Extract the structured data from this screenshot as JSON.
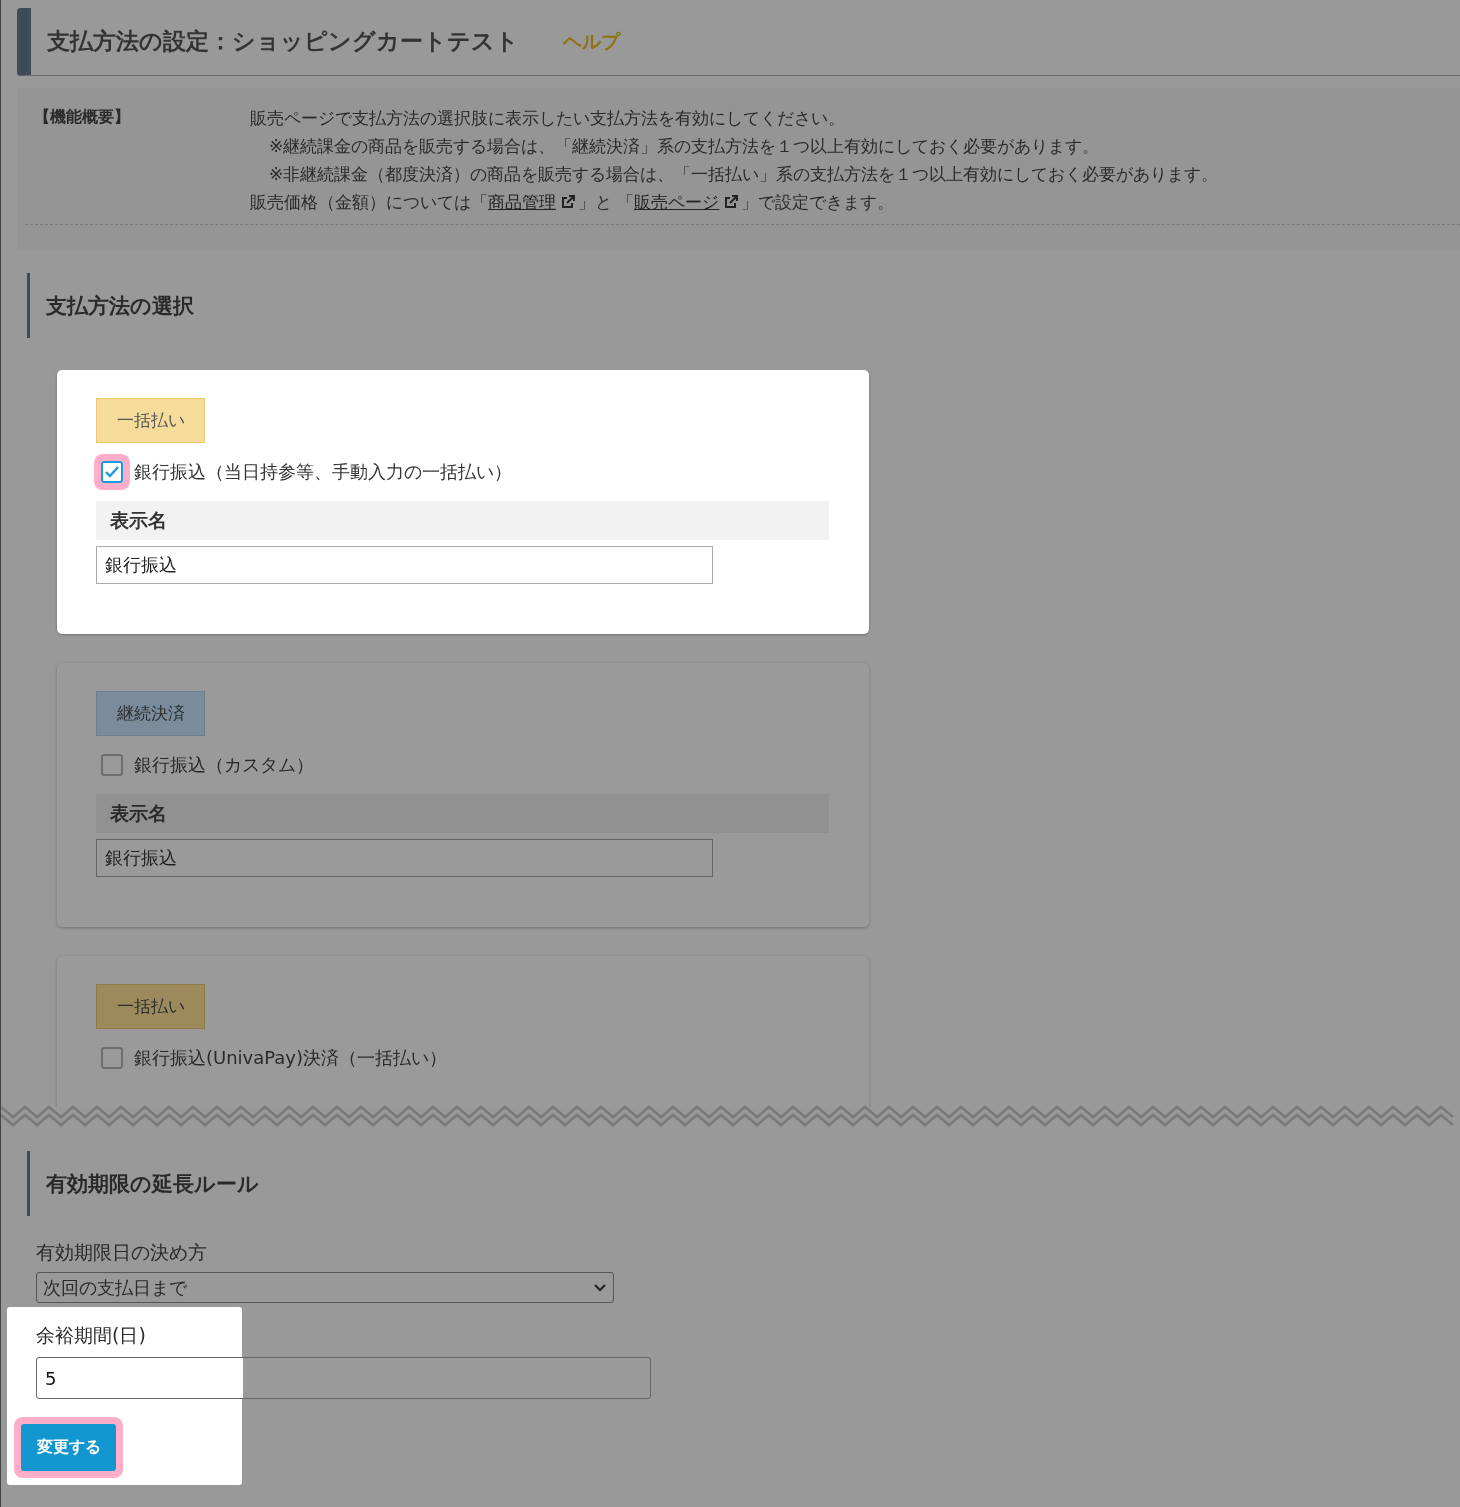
{
  "header": {
    "title": "支払方法の設定：ショッピングカートテスト",
    "help_link": "ヘルプ"
  },
  "overview": {
    "label": "【機能概要】",
    "lines": [
      {
        "kind": "main",
        "text": "販売ページで支払方法の選択肢に表示したい支払方法を有効にしてください。"
      },
      {
        "kind": "note",
        "text": "※継続課金の商品を販売する場合は、「継続決済」系の支払方法を１つ以上有効にしておく必要があります。"
      },
      {
        "kind": "note",
        "text": "※非継続課金（都度決済）の商品を販売する場合は、「一括払い」系の支払方法を１つ以上有効にしておく必要があります。"
      }
    ],
    "price_note": {
      "before": "販売価格（金額）については「",
      "link_1": "商品管理",
      "middle": "」と 「",
      "link_2": "販売ページ",
      "after": "」で設定できます。"
    }
  },
  "payment_section": {
    "heading": "支払方法の選択",
    "cards": [
      {
        "spotlight": true,
        "badge": {
          "label": "一括払い",
          "kind": "lump"
        },
        "option": {
          "label": "銀行振込（当日持参等、手動入力の一括払い）",
          "checked": true,
          "highlighted": true
        },
        "field": {
          "label": "表示名",
          "value": "銀行振込"
        }
      },
      {
        "spotlight": false,
        "badge": {
          "label": "継続決済",
          "kind": "recurring"
        },
        "option": {
          "label": "銀行振込（カスタム）",
          "checked": false,
          "highlighted": false
        },
        "field": {
          "label": "表示名",
          "value": "銀行振込"
        }
      },
      {
        "spotlight": false,
        "badge": {
          "label": "一括払い",
          "kind": "lump"
        },
        "option": {
          "label": "銀行振込(UnivaPay)決済（一括払い）",
          "checked": false,
          "highlighted": false
        }
      }
    ]
  },
  "expiry_section": {
    "heading": "有効期限の延長ルール",
    "method": {
      "label": "有効期限日の決め方",
      "value": "次回の支払日まで"
    },
    "grace": {
      "label": "余裕期間(日)",
      "value": "5"
    },
    "submit": {
      "label": "変更する",
      "highlighted": true
    }
  }
}
